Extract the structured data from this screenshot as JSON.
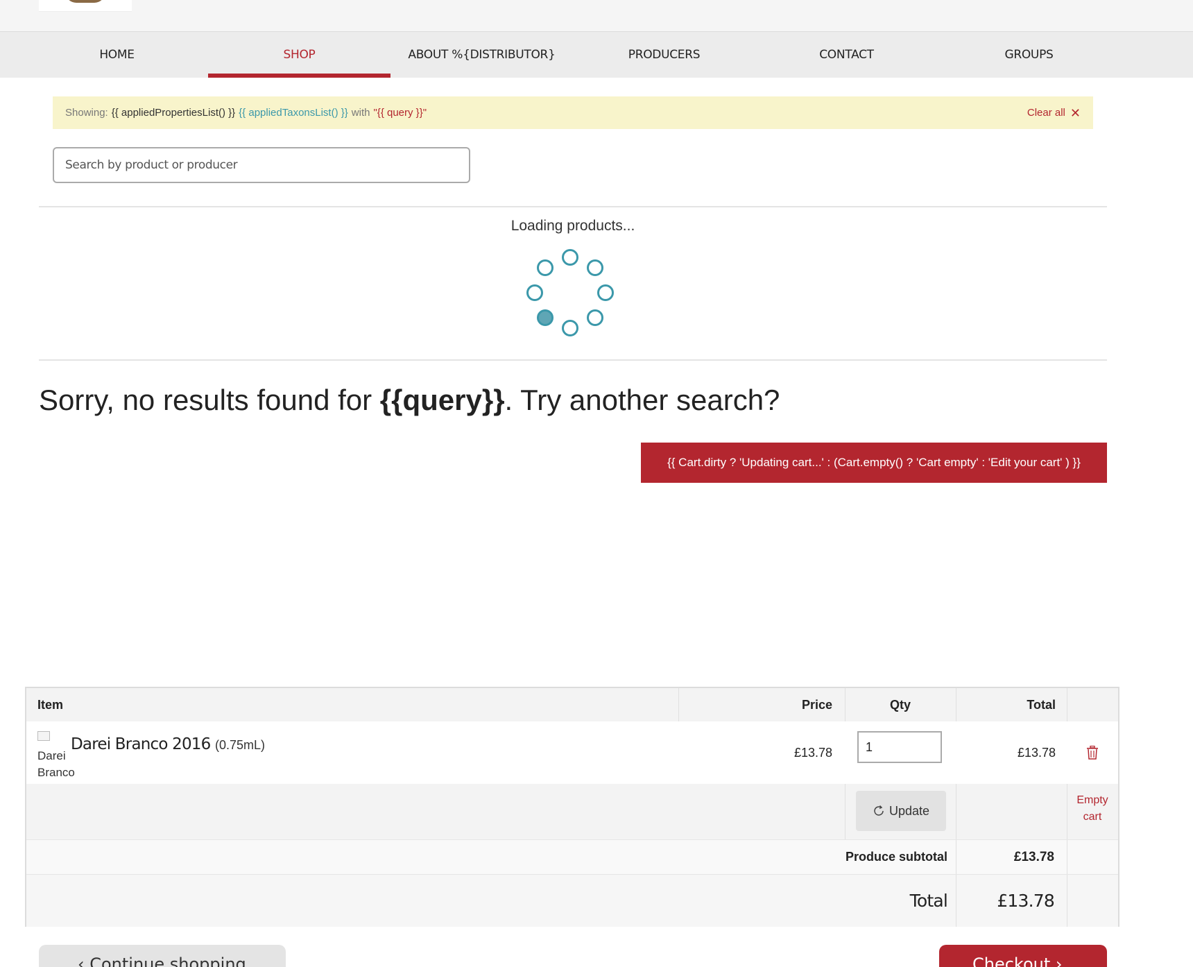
{
  "nav": {
    "items": [
      {
        "label": "HOME"
      },
      {
        "label": "SHOP"
      },
      {
        "label": "ABOUT %{DISTRIBUTOR}"
      },
      {
        "label": "PRODUCERS"
      },
      {
        "label": "CONTACT"
      },
      {
        "label": "GROUPS"
      }
    ],
    "active_item": "SHOP",
    "accent_color": "#b3262f"
  },
  "filter": {
    "label": "Showing:",
    "properties": "{{ appliedPropertiesList() }}",
    "taxons": "{{ appliedTaxonsList() }}",
    "with": "with",
    "query": "\"{{ query }}\"",
    "clear_all": "Clear all"
  },
  "search": {
    "placeholder": "Search by product or producer",
    "value": ""
  },
  "loading": {
    "text": "Loading products..."
  },
  "no_results": {
    "prefix": "Sorry, no results found for ",
    "query": "{{query}}",
    "suffix": ". Try another search?"
  },
  "cart_banner": {
    "label": "{{ Cart.dirty ? 'Updating cart...' : (Cart.empty() ? 'Cart empty' : 'Edit your cart' ) }}"
  },
  "cart_table": {
    "headers": {
      "item": "Item",
      "price": "Price",
      "qty": "Qty",
      "total": "Total"
    },
    "items": [
      {
        "image_alt": "Darei Branco",
        "name": "Darei Branco 2016",
        "unit": "(0.75mL)",
        "price": "£13.78",
        "qty": "1",
        "total": "£13.78"
      }
    ],
    "update_label": "Update",
    "empty_cart_label": "Empty cart",
    "produce_subtotal_label": "Produce subtotal",
    "produce_subtotal": "£13.78",
    "total_label": "Total",
    "total": "£13.78"
  },
  "footer_buttons": {
    "continue_label": "Continue shopping",
    "checkout_label": "Checkout"
  },
  "icons": {
    "clear": "close-icon",
    "remove": "trash-icon",
    "update": "refresh-icon",
    "back": "chevron-left-icon",
    "forward": "chevron-right-icon"
  }
}
